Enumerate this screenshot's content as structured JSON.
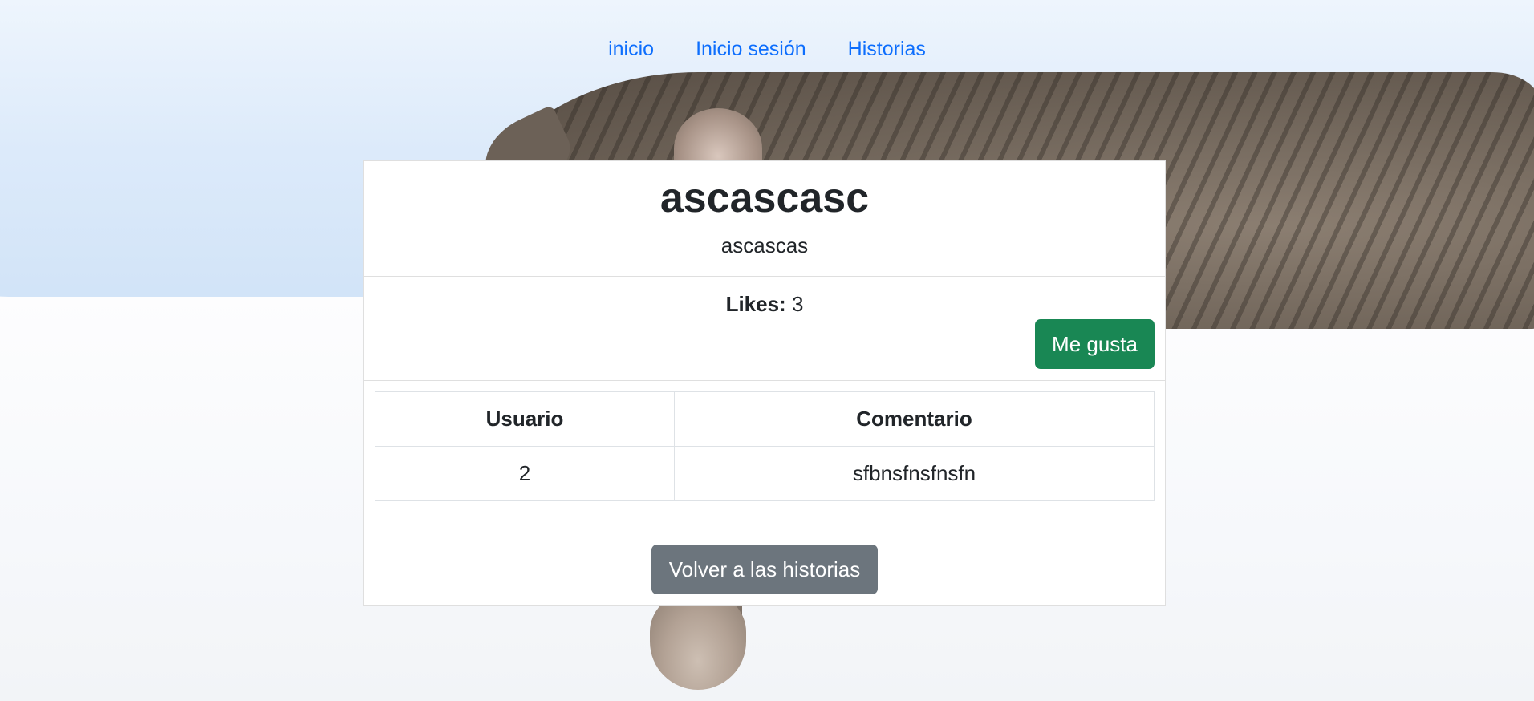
{
  "nav": {
    "items": [
      {
        "label": "inicio"
      },
      {
        "label": "Inicio sesión"
      },
      {
        "label": "Historias"
      }
    ]
  },
  "story": {
    "title": "ascascasc",
    "subtitle": "ascascas"
  },
  "likes": {
    "label": "Likes:",
    "count": "3",
    "like_button": "Me gusta"
  },
  "comments": {
    "headers": [
      "Usuario",
      "Comentario"
    ],
    "rows": [
      {
        "user": "2",
        "comment": "sfbnsfnsfnsfn"
      }
    ]
  },
  "footer": {
    "back_button": "Volver a las historias"
  },
  "colors": {
    "link": "#0d6efd",
    "success": "#198754",
    "secondary": "#6c757d"
  }
}
